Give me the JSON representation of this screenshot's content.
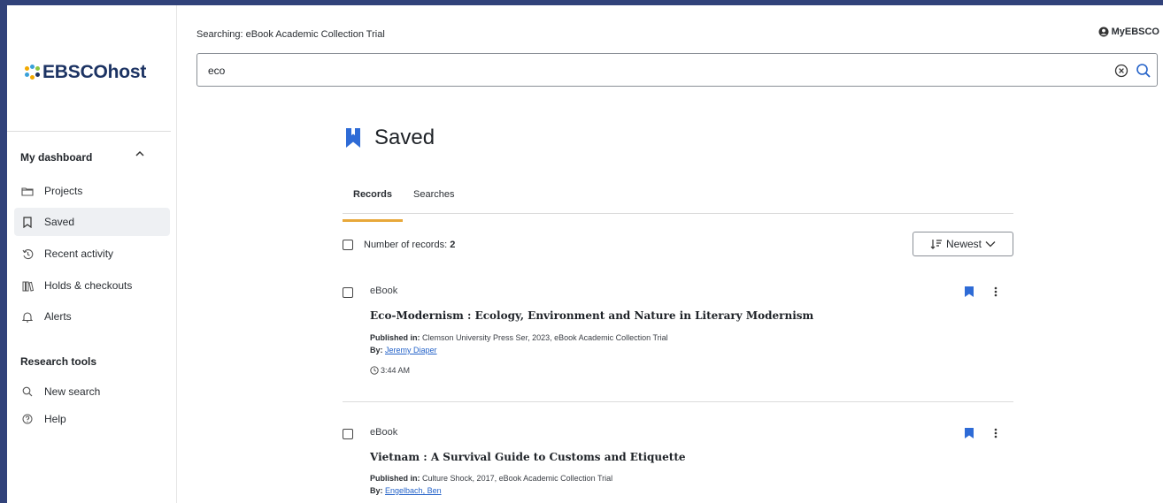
{
  "header": {
    "searching_label": "Searching:  eBook Academic Collection Trial",
    "myebsco_label": "MyEBSCO"
  },
  "logo": {
    "text": "EBSCOhost"
  },
  "search": {
    "value": "eco",
    "placeholder": ""
  },
  "sidebar": {
    "dashboard_heading": "My dashboard",
    "items": [
      {
        "label": "Projects",
        "icon": "folder-icon"
      },
      {
        "label": "Saved",
        "icon": "bookmark-icon"
      },
      {
        "label": "Recent activity",
        "icon": "history-icon"
      },
      {
        "label": "Holds & checkouts",
        "icon": "books-icon"
      },
      {
        "label": "Alerts",
        "icon": "bell-icon"
      }
    ],
    "research_heading": "Research tools",
    "tools": [
      {
        "label": "New search",
        "icon": "search-icon"
      },
      {
        "label": "Help",
        "icon": "help-icon"
      }
    ]
  },
  "main": {
    "title": "Saved",
    "tabs": [
      {
        "label": "Records"
      },
      {
        "label": "Searches"
      }
    ],
    "records_label": "Number of records:",
    "records_count": "2",
    "sort_label": "Newest",
    "records": [
      {
        "type": "eBook",
        "title": "Eco-Modernism : Ecology, Environment and Nature in Literary Modernism",
        "published_label": "Published in:",
        "published": "Clemson University Press Ser, 2023, eBook Academic Collection Trial",
        "by_label": "By:",
        "author": "Jeremy Diaper",
        "time": "3:44 AM"
      },
      {
        "type": "eBook",
        "title": "Vietnam : A Survival Guide to Customs and Etiquette",
        "published_label": "Published in:",
        "published": "Culture Shock, 2017, eBook Academic Collection Trial",
        "by_label": "By:",
        "author": "Engelbach, Ben"
      }
    ]
  },
  "colors": {
    "brand_navy": "#31427a",
    "accent_blue": "#2563c9",
    "tab_underline": "#e8a83a"
  }
}
